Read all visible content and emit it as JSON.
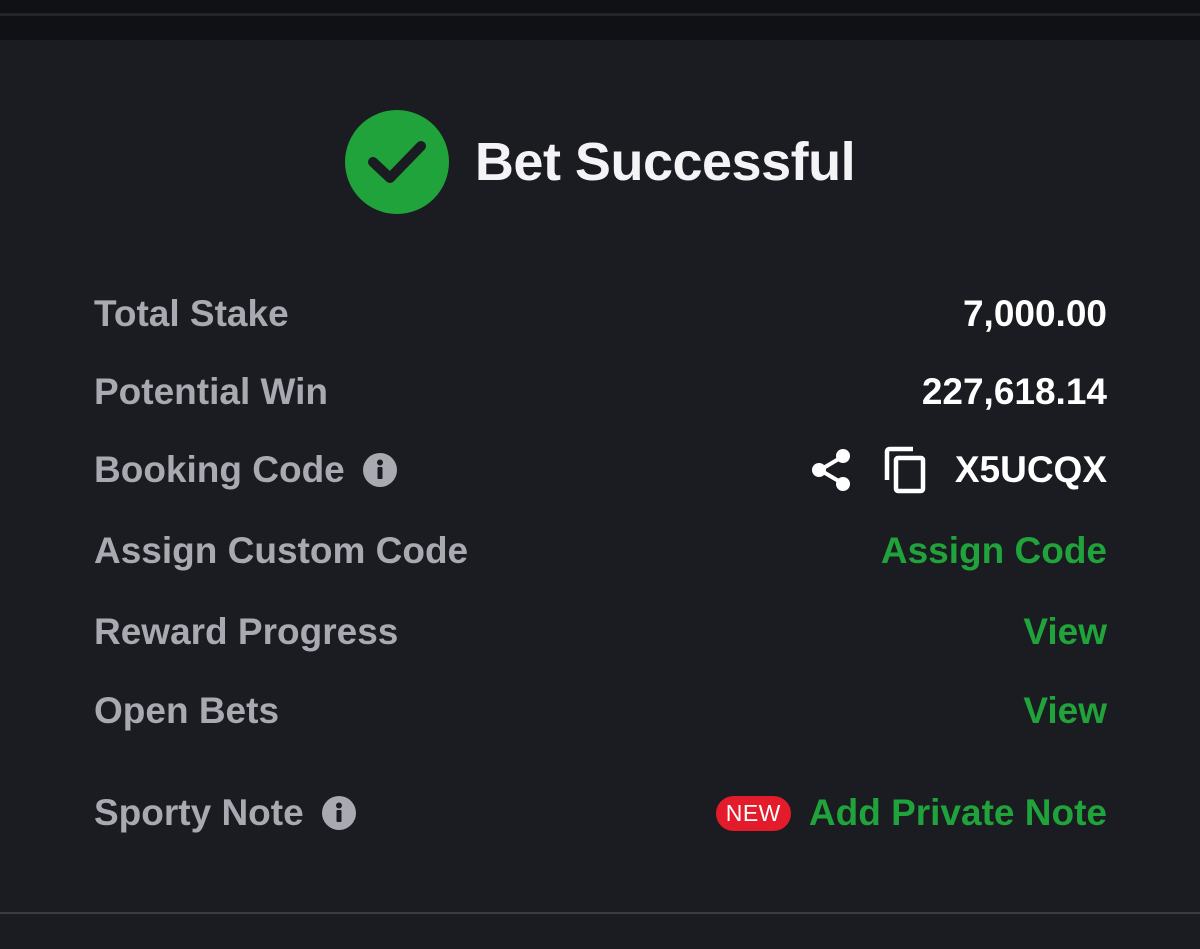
{
  "header": {
    "title": "Bet Successful",
    "status_icon": "check-circle-icon",
    "status_color": "#1fa33a"
  },
  "rows": {
    "total_stake": {
      "label": "Total Stake",
      "value": "7,000.00"
    },
    "potential_win": {
      "label": "Potential Win",
      "value": "227,618.14"
    },
    "booking_code": {
      "label": "Booking Code",
      "value": "X5UCQX",
      "info_icon": "info-icon",
      "share_icon": "share-icon",
      "copy_icon": "copy-icon"
    },
    "assign_custom_code": {
      "label": "Assign Custom Code",
      "action": "Assign Code"
    },
    "reward_progress": {
      "label": "Reward Progress",
      "action": "View"
    },
    "open_bets": {
      "label": "Open Bets",
      "action": "View"
    },
    "sporty_note": {
      "label": "Sporty Note",
      "badge": "NEW",
      "action": "Add Private Note",
      "info_icon": "info-icon"
    }
  },
  "colors": {
    "background": "#1b1c22",
    "accent_green": "#1fa33a",
    "badge_red": "#e41b2b",
    "label_grey": "#a9aab1"
  }
}
